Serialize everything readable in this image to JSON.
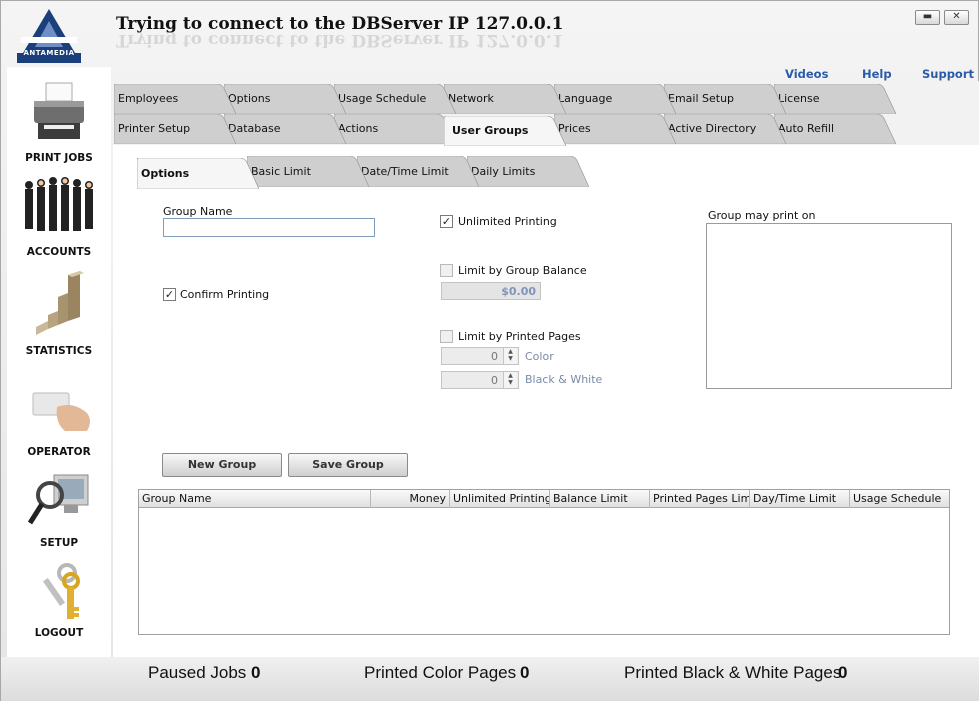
{
  "app": {
    "title": "Trying to connect to the DBServer IP 127.0.0.1",
    "logo_text": "ANTAMEDIA",
    "minimize": "▬",
    "close": "✕"
  },
  "top_links": {
    "videos": "Videos",
    "help": "Help",
    "support": "Support"
  },
  "sidebar": {
    "items": [
      {
        "label": "PRINT JOBS",
        "icon": "printer-icon"
      },
      {
        "label": "ACCOUNTS",
        "icon": "people-icon"
      },
      {
        "label": "STATISTICS",
        "icon": "bar-chart-icon"
      },
      {
        "label": "OPERATOR",
        "icon": "card-hand-icon"
      },
      {
        "label": "SETUP",
        "icon": "magnifier-monitor-icon"
      },
      {
        "label": "LOGOUT",
        "icon": "keys-icon"
      }
    ]
  },
  "tabs_row1": [
    "Employees",
    "Options",
    "Usage Schedule",
    "Network",
    "Language",
    "Email Setup",
    "License"
  ],
  "tabs_row2": [
    "Printer Setup",
    "Database",
    "Actions",
    "User Groups",
    "Prices",
    "Active Directory",
    "Auto Refill"
  ],
  "active_tab": "User Groups",
  "subtabs": [
    "Options",
    "Basic Limit",
    "Date/Time Limit",
    "Daily Limits"
  ],
  "active_subtab": "Options",
  "form": {
    "group_name_label": "Group Name",
    "group_name_value": "",
    "confirm_printing_label": "Confirm Printing",
    "confirm_printing_checked": true,
    "unlimited_printing_label": "Unlimited Printing",
    "unlimited_printing_checked": true,
    "limit_group_balance_label": "Limit by Group Balance",
    "limit_group_balance_checked": false,
    "balance_value": "$0.00",
    "limit_printed_pages_label": "Limit by Printed Pages",
    "limit_printed_pages_checked": false,
    "color_value": "0",
    "color_label": "Color",
    "bw_value": "0",
    "bw_label": "Black & White",
    "may_print_on_label": "Group may print on"
  },
  "buttons": {
    "new_group": "New Group",
    "save_group": "Save Group"
  },
  "table": {
    "columns": [
      "Group Name",
      "Money",
      "Unlimited Printing",
      "Balance Limit",
      "Printed Pages Limit",
      "Day/Time Limit",
      "Usage Schedule"
    ],
    "rows": []
  },
  "status": {
    "paused_jobs_label": "Paused Jobs",
    "paused_jobs_value": "0",
    "color_pages_label": "Printed Color Pages",
    "color_pages_value": "0",
    "bw_pages_label": "Printed Black & White Pages",
    "bw_pages_value": "0"
  },
  "colors": {
    "link": "#2a5ba8",
    "logo": "#1a3f7a",
    "disabled_text": "#7a8aa8"
  }
}
